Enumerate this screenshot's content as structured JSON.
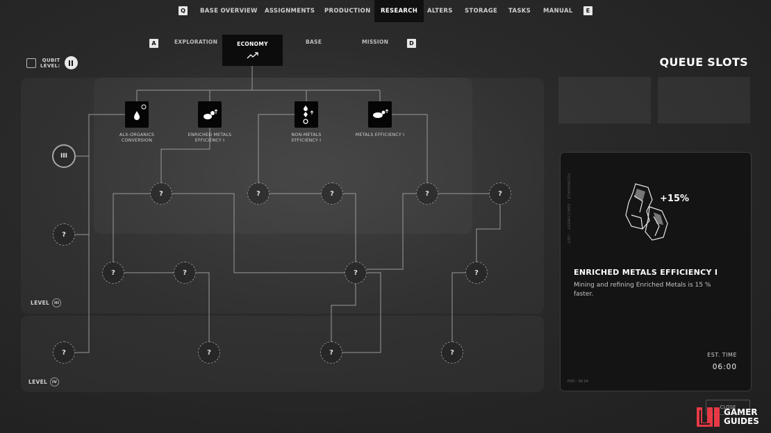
{
  "nav": {
    "left_key": "Q",
    "right_key": "E",
    "items": [
      {
        "label": "BASE OVERVIEW"
      },
      {
        "label": "ASSIGNMENTS"
      },
      {
        "label": "PRODUCTION"
      },
      {
        "label": "RESEARCH",
        "active": true
      },
      {
        "label": "ALTERS"
      },
      {
        "label": "STORAGE"
      },
      {
        "label": "TASKS"
      },
      {
        "label": "MANUAL"
      }
    ]
  },
  "subtabs": {
    "left_key": "A",
    "right_key": "D",
    "items": [
      {
        "label": "EXPLORATION"
      },
      {
        "label": "ECONOMY",
        "active": true
      },
      {
        "label": "BASE"
      },
      {
        "label": "MISSION"
      }
    ]
  },
  "qubit": {
    "line1": "QUBIT",
    "line2": "LEVEL:"
  },
  "tech_nodes": [
    {
      "label": "ALX-ORGANICS CONVERSION",
      "icon": "alx-organics-icon"
    },
    {
      "label": "ENRICHED METALS EFFICIENCY I",
      "icon": "enriched-metals-icon"
    },
    {
      "label": "NON-METALS EFFICIENCY I",
      "icon": "non-metals-icon"
    },
    {
      "label": "METALS EFFICIENCY I",
      "icon": "metals-icon"
    }
  ],
  "locked_symbol": "?",
  "tier_badge": "III",
  "levels": [
    {
      "label": "LEVEL",
      "roman": "III"
    },
    {
      "label": "LEVEL",
      "roman": "IV"
    }
  ],
  "queue": {
    "title": "QUEUE SLOTS"
  },
  "detail": {
    "bonus": "+15%",
    "title": "ENRICHED METALS EFFICIENCY I",
    "description": "Mining and refining Enriched Metals is 15 % faster.",
    "est_label": "EST. TIME",
    "est_value": "06:00"
  },
  "close_label": "CLOSE",
  "watermark": {
    "line1": "GAMER",
    "line2": "GUIDES"
  }
}
